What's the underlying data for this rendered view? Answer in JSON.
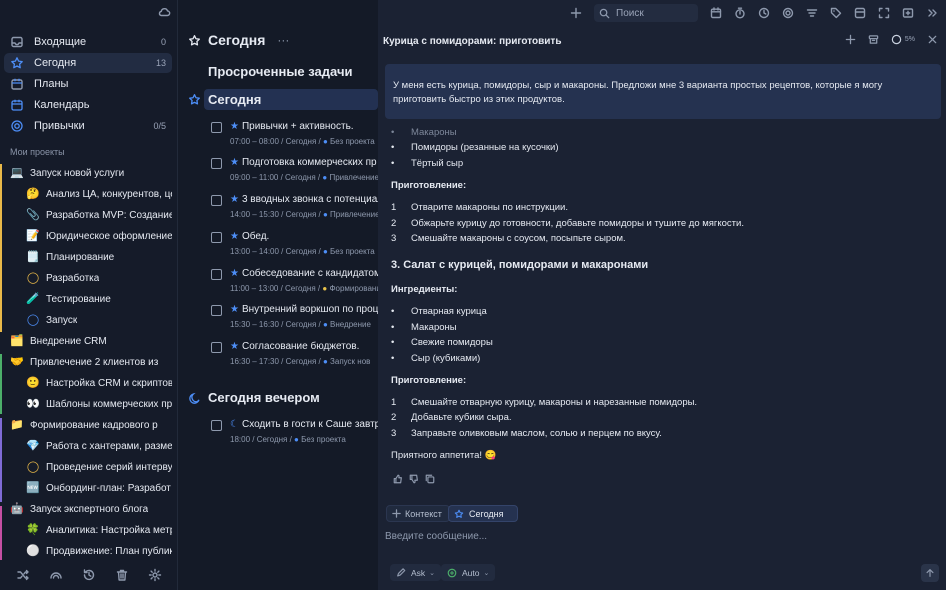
{
  "sidebar": {
    "nav": [
      {
        "label": "Входящие",
        "count": "0",
        "icon": "inbox-icon"
      },
      {
        "label": "Сегодня",
        "count": "13",
        "icon": "star-icon"
      },
      {
        "label": "Планы",
        "count": "",
        "icon": "calendar-icon"
      },
      {
        "label": "Календарь",
        "count": "",
        "icon": "calendar-icon"
      },
      {
        "label": "Привычки",
        "count": "0/5",
        "icon": "habit-icon"
      }
    ],
    "projects_heading": "Мои проекты",
    "projects": [
      {
        "icon": "💻",
        "label": "Запуск новой услуги",
        "sub": false
      },
      {
        "icon": "🤔",
        "label": "Анализ ЦА, конкурентов, це",
        "sub": true
      },
      {
        "icon": "📎",
        "label": "Разработка MVP: Создание",
        "sub": true
      },
      {
        "icon": "📝",
        "label": "Юридическое оформление",
        "sub": true
      },
      {
        "icon": "🗒️",
        "label": "Планирование",
        "sub": true
      },
      {
        "icon": "◯",
        "label": "Разработка",
        "sub": true
      },
      {
        "icon": "🧪",
        "label": "Тестирование",
        "sub": true
      },
      {
        "icon": "◯",
        "label": "Запуск",
        "sub": true
      },
      {
        "icon": "🗂️",
        "label": "Внедрение CRM",
        "sub": false
      },
      {
        "icon": "🤝",
        "label": "Привлечение 2 клиентов из",
        "sub": false
      },
      {
        "icon": "🙂",
        "label": "Настройка CRM и скриптов",
        "sub": true
      },
      {
        "icon": "👀",
        "label": "Шаблоны коммерческих пр",
        "sub": true
      },
      {
        "icon": "📁",
        "label": "Формирование кадрового р",
        "sub": false
      },
      {
        "icon": "💎",
        "label": "Работа с хантерами, разме",
        "sub": true
      },
      {
        "icon": "◯",
        "label": "Проведение серий интерву",
        "sub": true
      },
      {
        "icon": "🆕",
        "label": "Онбординг-план: Разработ",
        "sub": true
      },
      {
        "icon": "🤖",
        "label": "Запуск экспертного блога",
        "sub": false
      },
      {
        "icon": "🍀",
        "label": "Аналитика: Настройка метр",
        "sub": true
      },
      {
        "icon": "⚪",
        "label": "Продвижение: План публик",
        "sub": true
      }
    ]
  },
  "middle": {
    "title": "Сегодня",
    "overdue_section": "Просроченные задачи",
    "today_section": "Сегодня",
    "evening_section": "Сегодня вечером",
    "tasks": [
      {
        "title": "Привычки + активность.",
        "time": "07:00 – 08:00",
        "when": "Сегодня",
        "project": "Без проекта"
      },
      {
        "title": "Подготовка коммерческих пр",
        "time": "09:00 – 11:00",
        "when": "Сегодня",
        "project": "Привлечение"
      },
      {
        "title": "3 вводных звонка с потенциал",
        "time": "14:00 – 15:30",
        "when": "Сегодня",
        "project": "Привлечение"
      },
      {
        "title": "Обед.",
        "time": "13:00 – 14:00",
        "when": "Сегодня",
        "project": "Без проекта"
      },
      {
        "title": "Собеседование с кандидатом",
        "time": "11:00 – 13:00",
        "when": "Сегодня",
        "project": "Формирование"
      },
      {
        "title": "Внутренний воркшоп по проц",
        "time": "15:30 – 16:30",
        "when": "Сегодня",
        "project": "Внедрение"
      },
      {
        "title": "Согласование бюджетов.",
        "time": "16:30 – 17:30",
        "when": "Сегодня",
        "project": "Запуск нов"
      }
    ],
    "evening_tasks": [
      {
        "title": "Сходить в гости к Саше завтр",
        "time": "18:00",
        "when": "Сегодня",
        "project": "Без проекта"
      }
    ]
  },
  "panel": {
    "title": "Курица с помидорами: приготовить",
    "progress_label": "5%",
    "user_message": "У меня есть курица, помидоры, сыр и макароны. Предложи мне 3 варианта простых рецептов, которые я могу приготовить быстро из этих продуктов.",
    "answer": {
      "cut_line": "Макароны",
      "r2_ingredients": [
        "Помидоры (резанные на кусочки)",
        "Тёртый сыр"
      ],
      "prep_heading": "Приготовление:",
      "r2_steps": [
        "Отварите макароны по инструкции.",
        "Обжарьте курицу до готовности, добавьте помидоры и тушите до мягкости.",
        "Смешайте макароны с соусом, посыпьте сыром."
      ],
      "r3_title": "3. Салат с курицей, помидорами и макаронами",
      "ingredients_heading": "Ингредиенты:",
      "r3_ingredients": [
        "Отварная курица",
        "Макароны",
        "Свежие помидоры",
        "Сыр (кубиками)"
      ],
      "r3_steps": [
        "Смешайте отварную курицу, макароны и нарезанные помидоры.",
        "Добавьте кубики сыра.",
        "Заправьте оливковым маслом, солью и перцем по вкусу."
      ],
      "closing": "Приятного аппетита! 😋",
      "step_numbers": [
        "1",
        "2",
        "3"
      ]
    },
    "composer": {
      "chip_context": "Контекст",
      "chip_today": "Сегодня",
      "placeholder": "Введите сообщение...",
      "mode": "Ask",
      "model": "Auto"
    }
  },
  "topbar": {
    "search_placeholder": "Поиск"
  },
  "colors": {
    "accent": "#4d8ef7",
    "background": "#151b29",
    "panel": "#1b2233",
    "user_bubble": "#253250"
  }
}
